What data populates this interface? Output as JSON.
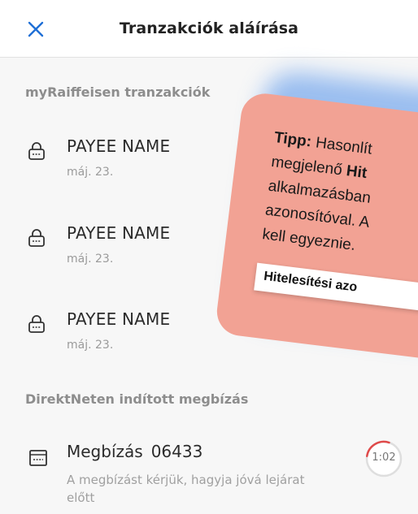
{
  "header": {
    "title": "Tranzakciók aláírása",
    "close_icon": "close-icon"
  },
  "sections": {
    "myraiffeisen": "myRaiffeisen tranzakciók",
    "direktnet": "DirektNeten indított megbízás"
  },
  "transactions": [
    {
      "name": "PAYEE NAME",
      "date": "máj. 23.",
      "icon": "lock-icon"
    },
    {
      "name": "PAYEE NAME",
      "date": "máj. 23.",
      "icon": "lock-icon"
    },
    {
      "name": "PAYEE NAME",
      "date": "máj. 23.",
      "icon": "lock-icon"
    }
  ],
  "order": {
    "title": "Megbízás",
    "id": "06433",
    "description": "A megbízást kérjük, hagyja jóvá lejárat előtt",
    "timer": "1:02",
    "icon": "terminal-icon"
  },
  "tip": {
    "lead": "Tipp:",
    "text_1": " Hasonlít",
    "text_2": "megjelenő ",
    "text_2_bold": "Hit",
    "text_3": "alkalmazásban",
    "text_4": "azonosítóval. A",
    "text_5": "kell egyeznie.",
    "chip": "Hitelesítési azo"
  },
  "colors": {
    "accent": "#1f6fd6",
    "tip_background": "#f2a294",
    "timer_ring": "#e04a4a"
  }
}
